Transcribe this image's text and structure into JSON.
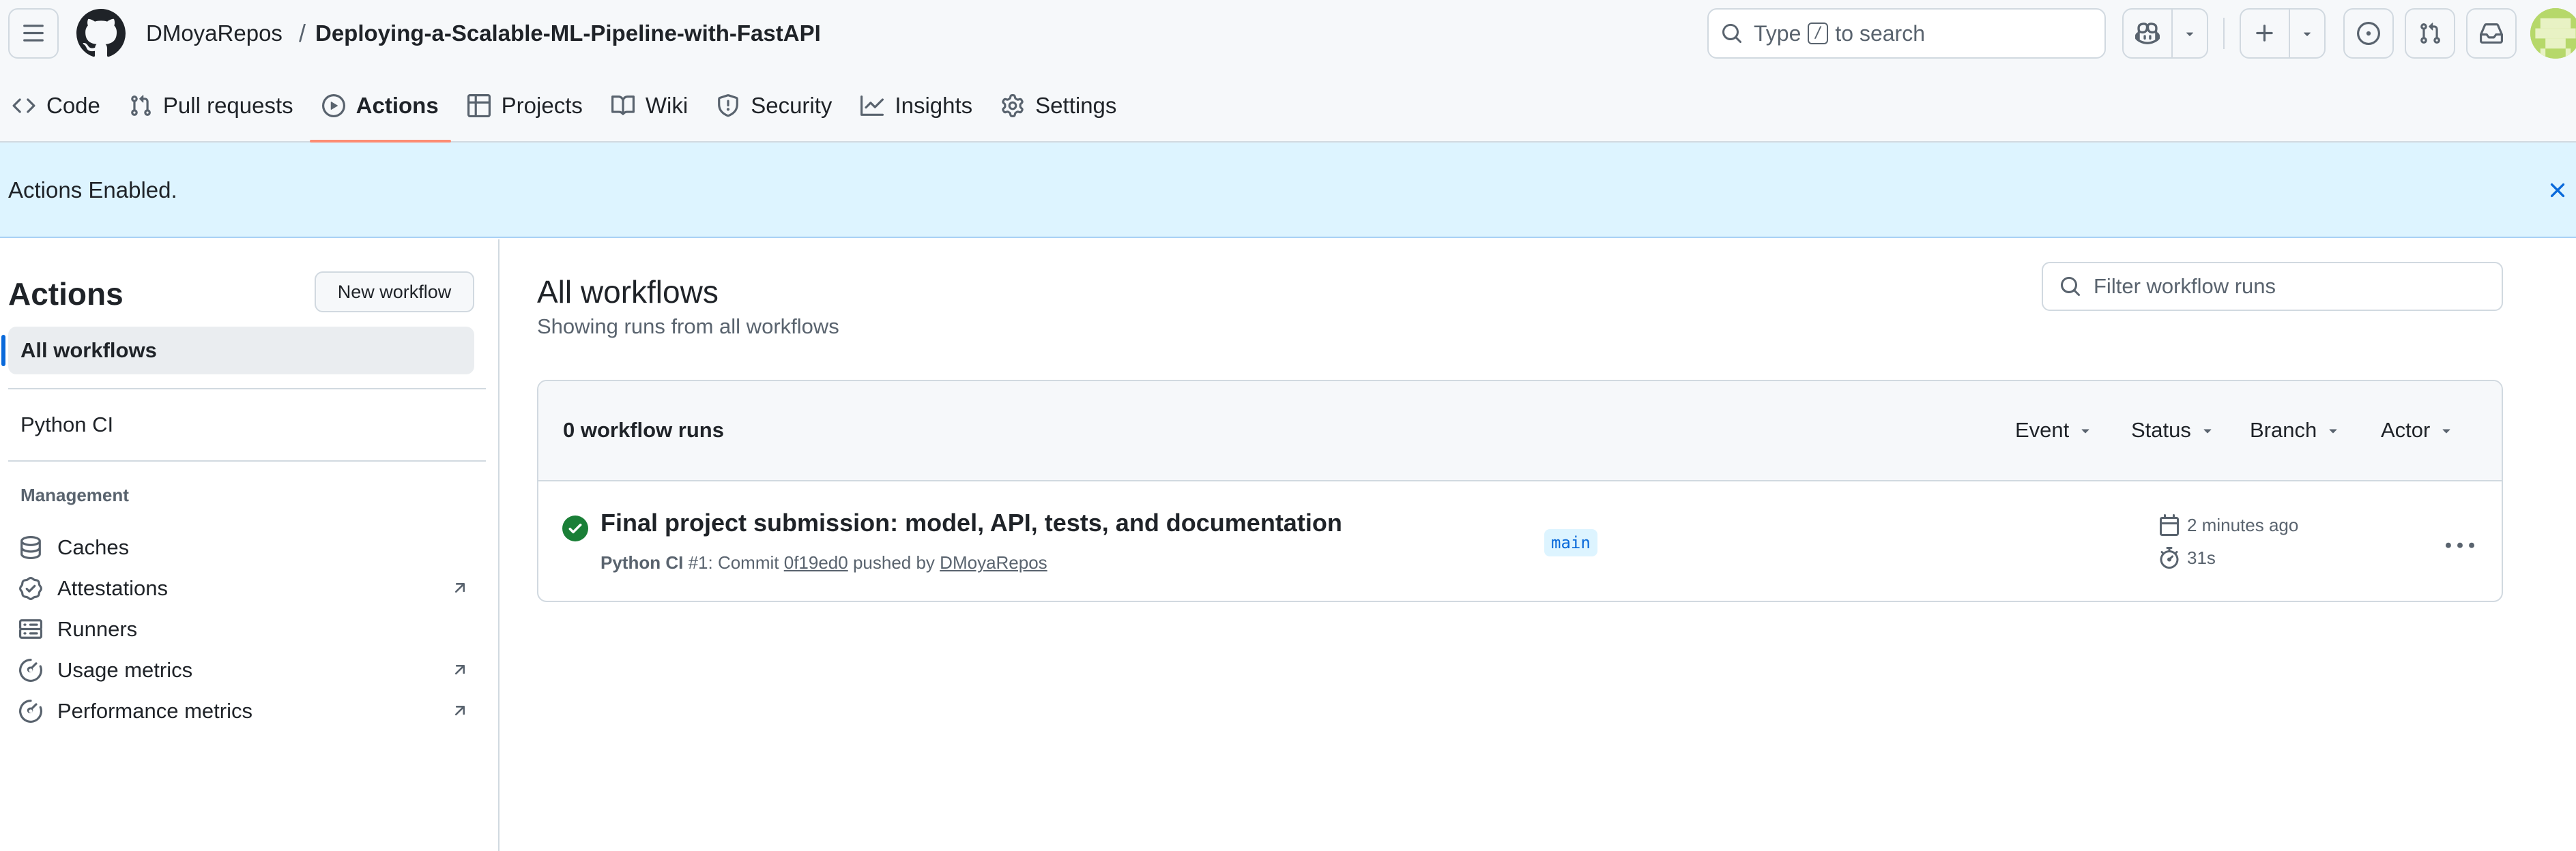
{
  "header": {
    "owner": "DMoyaRepos",
    "separator": "/",
    "repo": "Deploying-a-Scalable-ML-Pipeline-with-FastAPI",
    "search": {
      "prefix": "Type",
      "key": "/",
      "suffix": "to search"
    }
  },
  "tabs": [
    {
      "label": "Code",
      "icon": "code-icon"
    },
    {
      "label": "Pull requests",
      "icon": "git-pull-request-icon"
    },
    {
      "label": "Actions",
      "icon": "play-icon",
      "active": true
    },
    {
      "label": "Projects",
      "icon": "table-icon"
    },
    {
      "label": "Wiki",
      "icon": "book-icon"
    },
    {
      "label": "Security",
      "icon": "shield-icon"
    },
    {
      "label": "Insights",
      "icon": "graph-icon"
    },
    {
      "label": "Settings",
      "icon": "gear-icon"
    }
  ],
  "flash": {
    "message": "Actions Enabled."
  },
  "sidebar": {
    "title": "Actions",
    "new_workflow": "New workflow",
    "all_workflows": "All workflows",
    "workflows": [
      "Python CI"
    ],
    "management_heading": "Management",
    "management": [
      {
        "label": "Caches",
        "icon": "database-icon",
        "external": false
      },
      {
        "label": "Attestations",
        "icon": "verified-icon",
        "external": true
      },
      {
        "label": "Runners",
        "icon": "server-icon",
        "external": false
      },
      {
        "label": "Usage metrics",
        "icon": "meter-icon",
        "external": true
      },
      {
        "label": "Performance metrics",
        "icon": "meter-icon",
        "external": true
      }
    ]
  },
  "main": {
    "title": "All workflows",
    "subtitle": "Showing runs from all workflows",
    "filter_placeholder": "Filter workflow runs",
    "runs_count": "0 workflow runs",
    "filters": [
      "Event",
      "Status",
      "Branch",
      "Actor"
    ],
    "run": {
      "title": "Final project submission: model, API, tests, and documentation",
      "workflow": "Python CI",
      "run_number": "#1",
      "meta_mid": ": Commit",
      "commit": "0f19ed0",
      "pushed_by": "pushed by",
      "actor": "DMoyaRepos",
      "branch": "main",
      "time_ago": "2 minutes ago",
      "duration": "31s",
      "status": "success"
    }
  },
  "colors": {
    "accent": "#0969da",
    "success": "#1a7f37",
    "tab_underline": "#fd8c73",
    "flash_bg": "#ddf4ff"
  }
}
